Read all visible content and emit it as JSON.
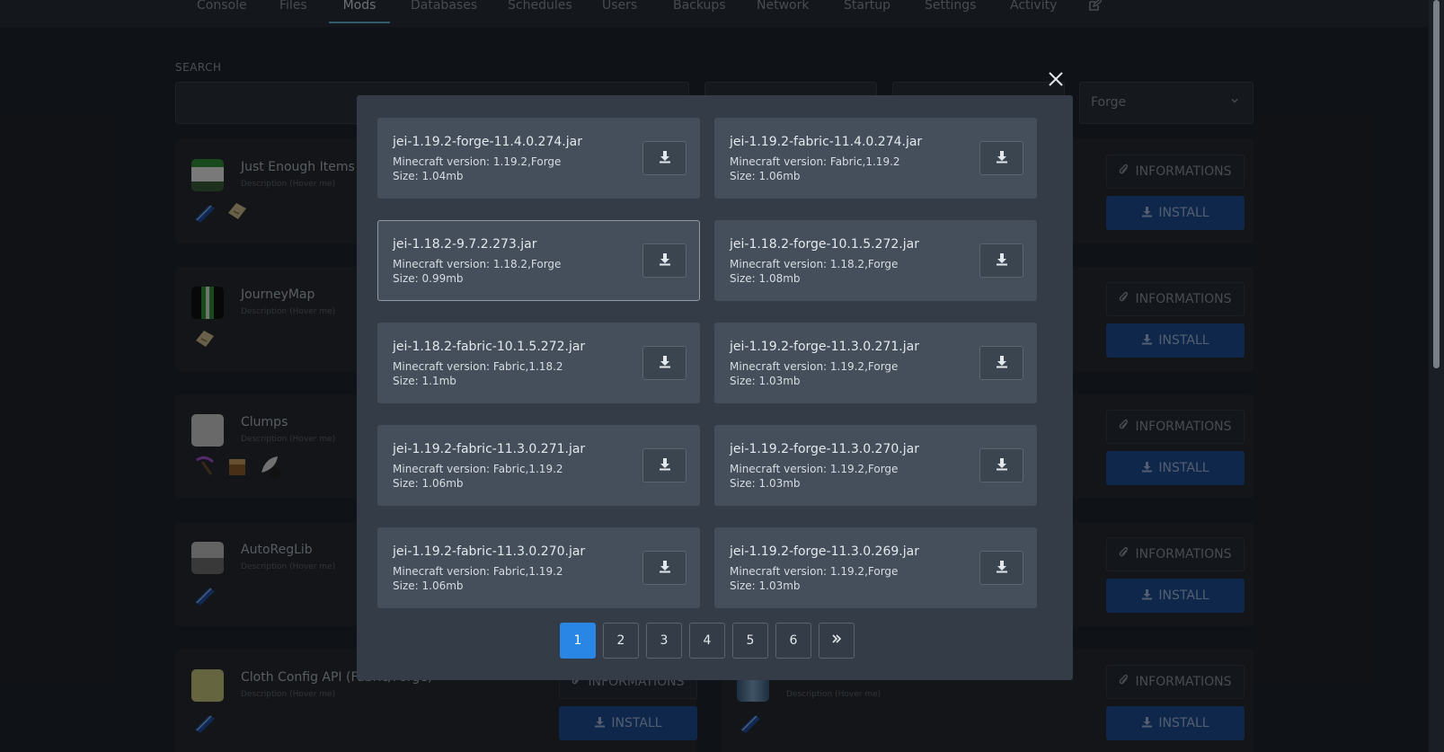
{
  "nav": {
    "tabs": [
      {
        "label": "Console"
      },
      {
        "label": "Files"
      },
      {
        "label": "Mods",
        "active": true
      },
      {
        "label": "Databases"
      },
      {
        "label": "Schedules"
      },
      {
        "label": "Users"
      },
      {
        "label": "Backups"
      },
      {
        "label": "Network"
      },
      {
        "label": "Startup"
      },
      {
        "label": "Settings"
      },
      {
        "label": "Activity"
      }
    ],
    "edit_icon": "external-edit-icon"
  },
  "search": {
    "label": "SEARCH",
    "value": "",
    "loader_value": "Forge"
  },
  "mods": [
    {
      "title": "Just Enough Items (",
      "desc": "Description (Hover me)"
    },
    {
      "title": "JourneyMap",
      "desc": "Description (Hover me)"
    },
    {
      "title": "Clumps",
      "desc": "Description (Hover me)"
    },
    {
      "title": "AutoRegLib",
      "desc": "Description (Hover me)"
    },
    {
      "title": "Cloth Config API (Fabric/Forge)",
      "desc": "Description (Hover me)"
    },
    {
      "title": "",
      "desc": "Description (Hover me)"
    }
  ],
  "buttons": {
    "info_label": "INFORMATIONS",
    "install_label": "INSTALL"
  },
  "modal": {
    "close_icon": "close-icon",
    "files": [
      {
        "name": "jei-1.19.2-forge-11.4.0.274.jar",
        "version": "Minecraft version: 1.19.2,Forge",
        "size": "Size: 1.04mb"
      },
      {
        "name": "jei-1.19.2-fabric-11.4.0.274.jar",
        "version": "Minecraft version: Fabric,1.19.2",
        "size": "Size: 1.06mb"
      },
      {
        "name": "jei-1.18.2-9.7.2.273.jar",
        "version": "Minecraft version: 1.18.2,Forge",
        "size": "Size: 0.99mb"
      },
      {
        "name": "jei-1.18.2-forge-10.1.5.272.jar",
        "version": "Minecraft version: 1.18.2,Forge",
        "size": "Size: 1.08mb"
      },
      {
        "name": "jei-1.18.2-fabric-10.1.5.272.jar",
        "version": "Minecraft version: Fabric,1.18.2",
        "size": "Size: 1.1mb"
      },
      {
        "name": "jei-1.19.2-forge-11.3.0.271.jar",
        "version": "Minecraft version: 1.19.2,Forge",
        "size": "Size: 1.03mb"
      },
      {
        "name": "jei-1.19.2-fabric-11.3.0.271.jar",
        "version": "Minecraft version: Fabric,1.19.2",
        "size": "Size: 1.06mb"
      },
      {
        "name": "jei-1.19.2-forge-11.3.0.270.jar",
        "version": "Minecraft version: 1.19.2,Forge",
        "size": "Size: 1.03mb"
      },
      {
        "name": "jei-1.19.2-fabric-11.3.0.270.jar",
        "version": "Minecraft version: Fabric,1.19.2",
        "size": "Size: 1.06mb"
      },
      {
        "name": "jei-1.19.2-forge-11.3.0.269.jar",
        "version": "Minecraft version: 1.19.2,Forge",
        "size": "Size: 1.03mb"
      }
    ],
    "pagination": {
      "pages": [
        "1",
        "2",
        "3",
        "4",
        "5",
        "6"
      ],
      "current": "1",
      "next_label": "»"
    }
  },
  "colors": {
    "accent": "#2a86e4",
    "install": "#1e4b8f",
    "modal_bg": "#333c47",
    "card_bg": "#444f5b"
  }
}
